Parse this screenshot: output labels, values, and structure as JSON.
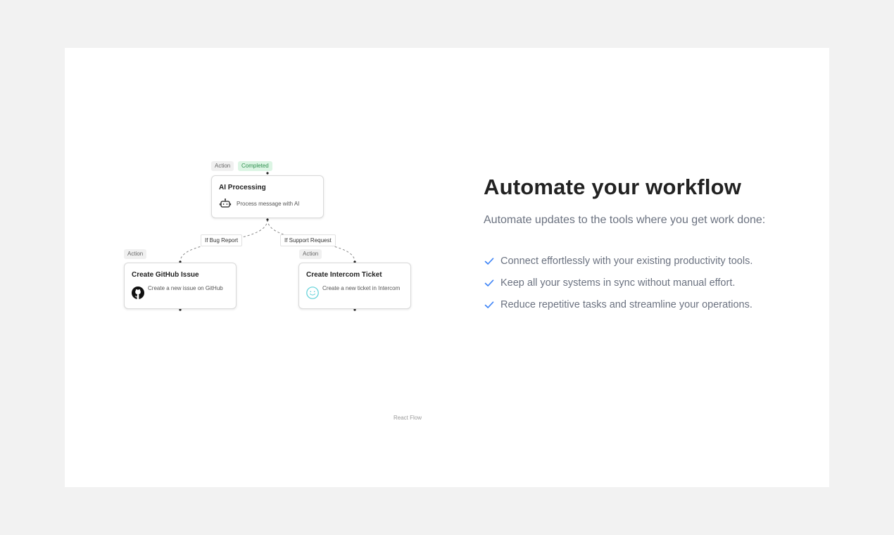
{
  "flow": {
    "nodes": {
      "ai": {
        "title": "AI Processing",
        "description": "Process message with AI",
        "icon": "bot-icon",
        "tags": [
          "Action",
          "Completed"
        ]
      },
      "github": {
        "title": "Create GitHub Issue",
        "description": "Create a new issue on GitHub",
        "icon": "github-icon",
        "tags": [
          "Action"
        ]
      },
      "intercom": {
        "title": "Create Intercom Ticket",
        "description": "Create a new ticket in Intercom",
        "icon": "intercom-smile-icon",
        "tags": [
          "Action"
        ]
      }
    },
    "edges": {
      "bug": "If Bug Report",
      "support": "If Support Request"
    },
    "attribution": "React Flow"
  },
  "content": {
    "title": "Automate your workflow",
    "subtitle": "Automate updates to the tools where you get work done:",
    "features": [
      "Connect effortlessly with your existing productivity tools.",
      "Keep all your systems in sync without manual effort.",
      "Reduce repetitive tasks and streamline your operations."
    ],
    "feature_icon": "check-icon"
  },
  "colors": {
    "page_background": "#f2f2f2",
    "card_background": "#ffffff",
    "check_accent": "#3b82f6",
    "completed_badge_bg": "#dcf5e4",
    "completed_badge_text": "#2f8f4e",
    "intercom_accent": "#5ed1d8"
  }
}
